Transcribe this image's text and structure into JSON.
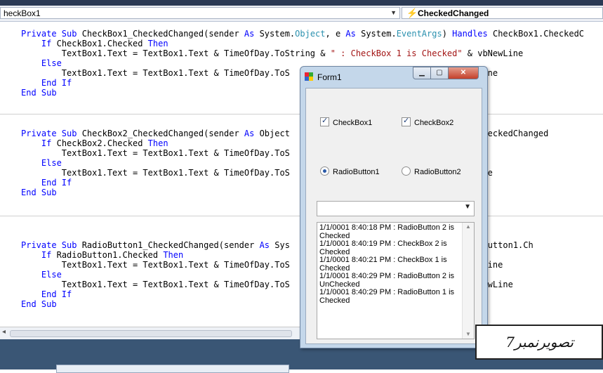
{
  "dropdowns": {
    "left_value": "heckBox1",
    "right_value": "CheckedChanged"
  },
  "code": {
    "block1": [
      [
        {
          "c": "kw",
          "t": "Private Sub "
        },
        {
          "t": "CheckBox1_CheckedChanged(sender "
        },
        {
          "c": "kw",
          "t": "As "
        },
        {
          "t": "System."
        },
        {
          "c": "ty",
          "t": "Object"
        },
        {
          "t": ", e "
        },
        {
          "c": "kw",
          "t": "As "
        },
        {
          "t": "System."
        },
        {
          "c": "ty",
          "t": "EventArgs"
        },
        {
          "t": ") "
        },
        {
          "c": "kw",
          "t": "Handles "
        },
        {
          "t": "CheckBox1.CheckedC"
        }
      ],
      [
        {
          "t": "    "
        },
        {
          "c": "kw",
          "t": "If "
        },
        {
          "t": "CheckBox1.Checked "
        },
        {
          "c": "kw",
          "t": "Then"
        }
      ],
      [
        {
          "t": "        TextBox1.Text = TextBox1.Text & TimeOfDay.ToString & "
        },
        {
          "c": "st",
          "t": "\" : CheckBox 1 is Checked\""
        },
        {
          "t": " & vbNewLine"
        }
      ],
      [
        {
          "t": "    "
        },
        {
          "c": "kw",
          "t": "Else"
        }
      ],
      [
        {
          "t": "        TextBox1.Text = TextBox1.Text & TimeOfDay.ToS                              & vbNewLine"
        }
      ],
      [
        {
          "t": "    "
        },
        {
          "c": "kw",
          "t": "End If"
        }
      ],
      [
        {
          "c": "kw",
          "t": "End Sub"
        }
      ]
    ],
    "block2": [
      [
        {
          "c": "kw",
          "t": "Private Sub "
        },
        {
          "t": "CheckBox2_CheckedChanged(sender "
        },
        {
          "c": "kw",
          "t": "As "
        },
        {
          "t": "Object                              ckBox2.CheckedChanged"
        }
      ],
      [
        {
          "t": "    "
        },
        {
          "c": "kw",
          "t": "If "
        },
        {
          "t": "CheckBox2.Checked "
        },
        {
          "c": "kw",
          "t": "Then"
        }
      ],
      [
        {
          "t": "        TextBox1.Text = TextBox1.Text & TimeOfDay.ToS                             vbNewLine"
        }
      ],
      [
        {
          "t": "    "
        },
        {
          "c": "kw",
          "t": "Else"
        }
      ],
      [
        {
          "t": "        TextBox1.Text = TextBox1.Text & TimeOfDay.ToS                             & vbNewLine"
        }
      ],
      [
        {
          "t": "    "
        },
        {
          "c": "kw",
          "t": "End If"
        }
      ],
      [
        {
          "c": "kw",
          "t": "End Sub"
        }
      ]
    ],
    "block3": [
      [
        {
          "c": "kw",
          "t": "Private Sub "
        },
        {
          "t": "RadioButton1_CheckedChanged(sender "
        },
        {
          "c": "kw",
          "t": "As "
        },
        {
          "t": "Sys                          "
        },
        {
          "c": "kw",
          "t": "andles "
        },
        {
          "t": "RadioButton1.Ch"
        }
      ],
      [
        {
          "t": "    "
        },
        {
          "c": "kw",
          "t": "If "
        },
        {
          "t": "RadioButton1.Checked "
        },
        {
          "c": "kw",
          "t": "Then"
        }
      ],
      [
        {
          "t": "        TextBox1.Text = TextBox1.Text & TimeOfDay.ToS                             "
        },
        {
          "c": "st",
          "t": "\""
        },
        {
          "t": " & vbNewLine"
        }
      ],
      [
        {
          "t": "    "
        },
        {
          "c": "kw",
          "t": "Else"
        }
      ],
      [
        {
          "t": "        TextBox1.Text = TextBox1.Text & TimeOfDay.ToS                             "
        },
        {
          "c": "st",
          "t": "ed\""
        },
        {
          "t": " & vbNewLine"
        }
      ],
      [
        {
          "t": "    "
        },
        {
          "c": "kw",
          "t": "End If"
        }
      ],
      [
        {
          "c": "kw",
          "t": "End Sub"
        }
      ]
    ]
  },
  "form": {
    "title": "Form1",
    "checkbox1": "CheckBox1",
    "checkbox2": "CheckBox2",
    "radio1": "RadioButton1",
    "radio2": "RadioButton2",
    "combobox_value": "",
    "log": [
      "1/1/0001 8:40:18 PM : RadioButton 2 is Checked",
      "1/1/0001 8:40:19 PM : CheckBox 2 is Checked",
      "1/1/0001 8:40:21 PM : CheckBox 1 is Checked",
      "1/1/0001 8:40:29 PM : RadioButton 2 is UnChecked",
      "1/1/0001 8:40:29 PM : RadioButton 1 is Checked"
    ]
  },
  "caption": "تصویرنمبر7",
  "icons": {
    "event_icon": "lightning-bolt-icon",
    "form_icon": "form-icon",
    "minimize": "minimize-icon",
    "maximize": "maximize-icon",
    "close": "close-icon"
  },
  "colors": {
    "keyword": "#0000ff",
    "type": "#2b91af",
    "string": "#a31515"
  }
}
